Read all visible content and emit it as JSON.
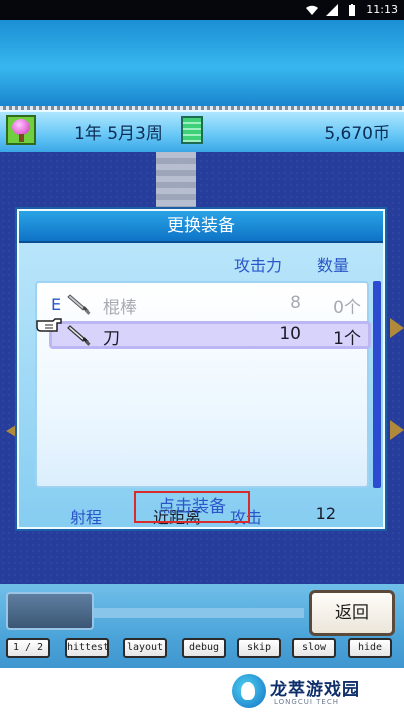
{
  "status_bar": {
    "time": "11:13"
  },
  "info_bar": {
    "date": "1年 5月3周",
    "money": "5,670币"
  },
  "dialog": {
    "title": "更换装备",
    "columns": {
      "attack": "攻击力",
      "quantity": "数量"
    },
    "items": [
      {
        "equipped_mark": "E",
        "name": "棍棒",
        "attack": "8",
        "quantity": "0个"
      },
      {
        "equipped_mark": "",
        "name": "刀",
        "attack": "10",
        "quantity": "1个"
      }
    ],
    "range_label": "射程",
    "range_value": "近距离",
    "attack_label": "攻击",
    "attack_value": "12",
    "equip_button": "点击装备"
  },
  "bottom": {
    "back_button": "返回",
    "debug_buttons": [
      "1 / 2",
      "hittest",
      "layout",
      "debug",
      "skip",
      "slow",
      "hide"
    ]
  },
  "watermark": {
    "title": "龙萃游戏园",
    "subtitle": "LONGCUI TECH"
  },
  "colors": {
    "accent_blue": "#2a56c8",
    "highlight": "#d7d3fb",
    "red_box": "#d82b2b"
  }
}
